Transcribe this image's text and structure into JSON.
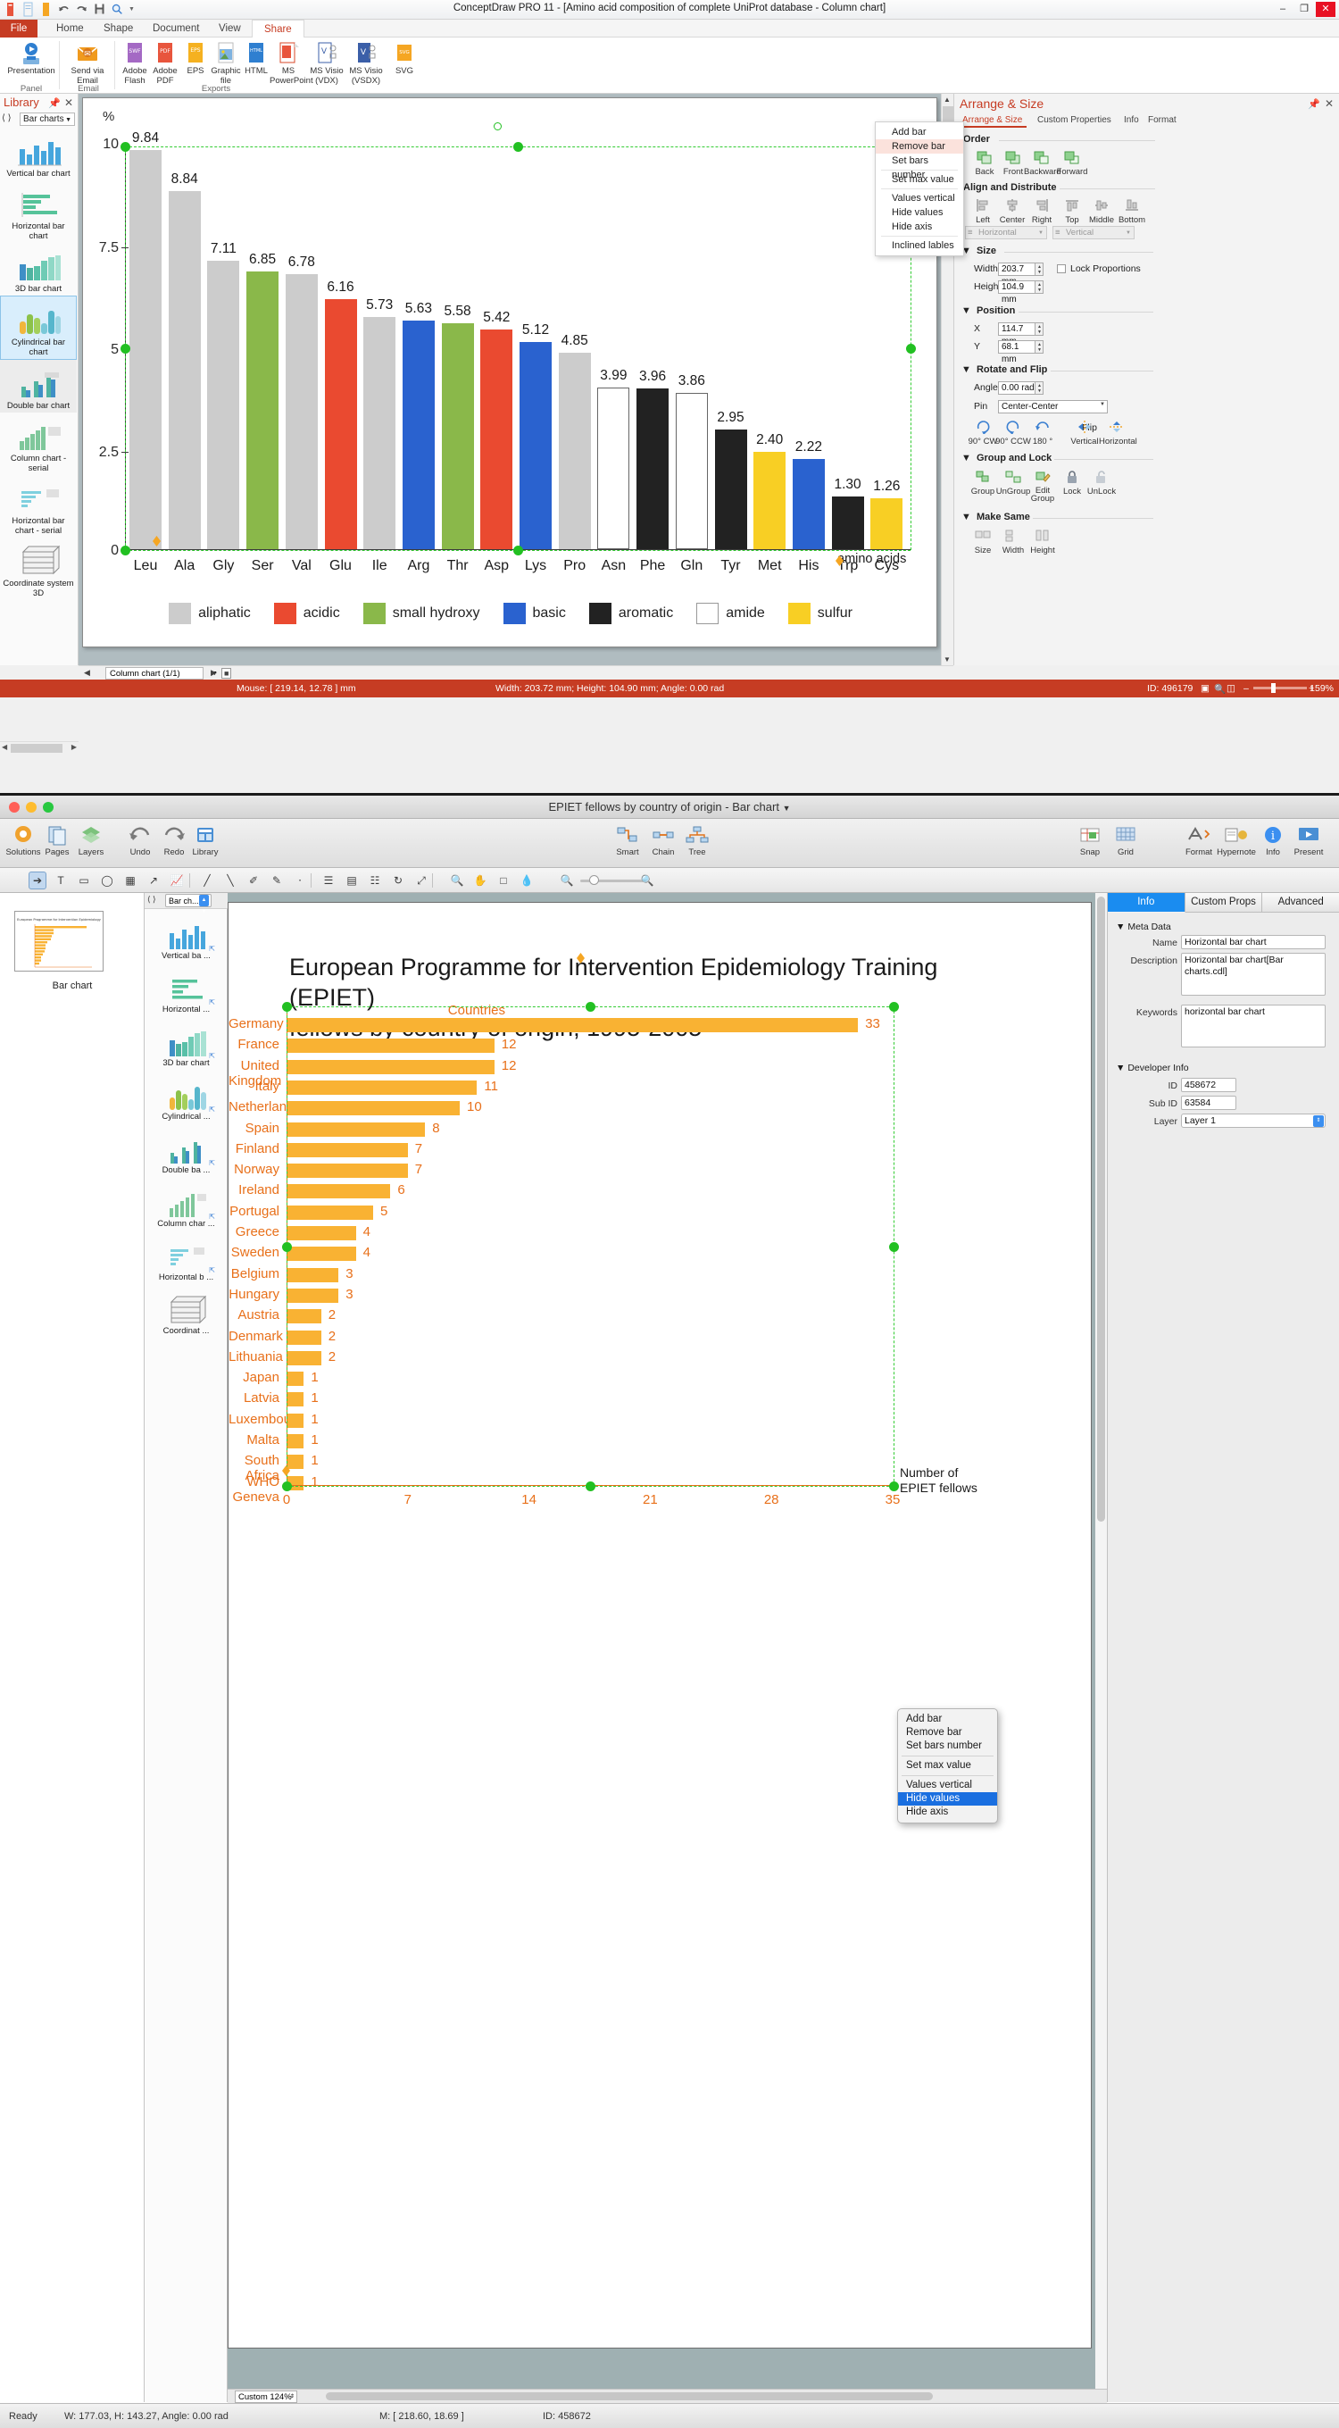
{
  "win1": {
    "title": "ConceptDraw PRO 11 - [Amino acid composition of complete UniProt database - Column chart]",
    "window_buttons": {
      "minimize": "–",
      "maximize": "❐",
      "close": "✕"
    },
    "ribbon_tabs": [
      {
        "label": "File"
      },
      {
        "label": "Home"
      },
      {
        "label": "Shape"
      },
      {
        "label": "Document"
      },
      {
        "label": "View"
      },
      {
        "label": "Share"
      }
    ],
    "ribbon_groups": [
      {
        "label": "Panel",
        "items": [
          {
            "label": "Presentation",
            "icon": "presentation-icon"
          }
        ]
      },
      {
        "label": "Email",
        "items": [
          {
            "label": "Send via Email",
            "icon": "email-icon"
          }
        ]
      },
      {
        "label": "Exports",
        "items": [
          {
            "label": "Adobe Flash",
            "icon": "swf-icon",
            "tag": "SWF"
          },
          {
            "label": "Adobe PDF",
            "icon": "pdf-icon",
            "tag": "PDF"
          },
          {
            "label": "EPS",
            "icon": "eps-icon",
            "tag": "EPS"
          },
          {
            "label": "Graphic file",
            "icon": "image-icon",
            "tag": ""
          },
          {
            "label": "HTML",
            "icon": "html-icon",
            "tag": "HTML"
          },
          {
            "label": "MS PowerPoint",
            "icon": "powerpoint-icon",
            "tag": ""
          },
          {
            "label": "MS Visio (VDX)",
            "icon": "visio-vdx-icon",
            "tag": "V"
          },
          {
            "label": "MS Visio (VSDX)",
            "icon": "visio-vsdx-icon",
            "tag": "V"
          },
          {
            "label": "SVG",
            "icon": "svg-icon",
            "tag": "SVG"
          }
        ]
      }
    ],
    "library": {
      "title": "Library",
      "selector_value": "Bar charts",
      "items": [
        {
          "label": "Vertical bar chart",
          "selected": false
        },
        {
          "label": "Horizontal bar chart",
          "selected": false
        },
        {
          "label": "3D bar chart",
          "selected": false
        },
        {
          "label": "Cylindrical bar chart",
          "selected": true
        },
        {
          "label": "Double bar chart",
          "selected": false
        },
        {
          "label": "Column chart - serial",
          "selected": false
        },
        {
          "label": "Horizontal bar chart - serial",
          "selected": false
        },
        {
          "label": "Coordinate system 3D",
          "selected": false
        }
      ]
    },
    "page_tab": "Column chart (1/1)",
    "context_menu": {
      "items": [
        {
          "label": "Add bar",
          "highlight": false
        },
        {
          "label": "Remove bar",
          "highlight": true
        },
        {
          "label": "Set bars number",
          "highlight": false
        },
        {
          "label": "Set max value",
          "highlight": false,
          "sep_before": true
        },
        {
          "label": "Values vertical",
          "highlight": false,
          "sep_before": true
        },
        {
          "label": "Hide values",
          "highlight": false
        },
        {
          "label": "Hide axis",
          "highlight": false
        },
        {
          "label": "Inclined lables",
          "highlight": false,
          "sep_before": true
        }
      ]
    },
    "dock": {
      "title": "Arrange & Size",
      "tabs": [
        {
          "label": "Arrange & Size",
          "active": true
        },
        {
          "label": "Custom Properties",
          "active": false
        },
        {
          "label": "Info",
          "active": false
        },
        {
          "label": "Format",
          "active": false
        }
      ],
      "sections": {
        "order": {
          "label": "Order",
          "buttons": [
            "Back",
            "Front",
            "Backward",
            "Forward"
          ]
        },
        "align": {
          "label": "Align and Distribute",
          "buttons": [
            "Left",
            "Center",
            "Right",
            "Top",
            "Middle",
            "Bottom"
          ],
          "dist_h": "Horizontal",
          "dist_v": "Vertical"
        },
        "size": {
          "label": "Size",
          "width_label": "Width",
          "width_value": "203.7 mm",
          "height_label": "Height",
          "height_value": "104.9 mm",
          "lock_label": "Lock Proportions"
        },
        "position": {
          "label": "Position",
          "x_label": "X",
          "x_value": "114.7 mm",
          "y_label": "Y",
          "y_value": "68.1 mm"
        },
        "rotate": {
          "label": "Rotate and Flip",
          "angle_label": "Angle",
          "angle_value": "0.00 rad",
          "pin_label": "Pin",
          "pin_value": "Center-Center",
          "buttons": [
            "90° CW",
            "90° CCW",
            "180 °",
            "Vertical",
            "Horizontal"
          ],
          "flip_label": "Flip"
        },
        "group": {
          "label": "Group and Lock",
          "buttons": [
            "Group",
            "UnGroup",
            "Edit Group",
            "Lock",
            "UnLock"
          ]
        },
        "same": {
          "label": "Make Same",
          "buttons": [
            "Size",
            "Width",
            "Height"
          ]
        }
      }
    },
    "status": {
      "mouse": "Mouse: [ 219.14, 12.78 ] mm",
      "dims": "Width: 203.72 mm;  Height: 104.90 mm;  Angle: 0.00 rad",
      "id": "ID: 496179",
      "zoom": "159%",
      "minus": "–",
      "plus": "+"
    }
  },
  "win2": {
    "title": "EPIET fellows by country of origin - Bar chart",
    "toolbar": [
      {
        "label": "Solutions",
        "icon": "solutions-icon"
      },
      {
        "label": "Pages",
        "icon": "pages-icon"
      },
      {
        "label": "Layers",
        "icon": "layers-icon"
      },
      {
        "label": "Undo",
        "icon": "undo-icon"
      },
      {
        "label": "Redo",
        "icon": "redo-icon"
      },
      {
        "label": "Library",
        "icon": "library-icon"
      },
      {
        "label": "Smart",
        "icon": "smart-connector-icon"
      },
      {
        "label": "Chain",
        "icon": "chain-connector-icon"
      },
      {
        "label": "Tree",
        "icon": "tree-connector-icon"
      },
      {
        "label": "Snap",
        "icon": "snap-icon"
      },
      {
        "label": "Grid",
        "icon": "grid-icon"
      },
      {
        "label": "Format",
        "icon": "format-icon"
      },
      {
        "label": "Hypernote",
        "icon": "hypernote-icon"
      },
      {
        "label": "Info",
        "icon": "info-icon"
      },
      {
        "label": "Present",
        "icon": "present-icon"
      }
    ],
    "pages": {
      "thumb_caption": "Bar chart"
    },
    "library": {
      "selector_value": "Bar ch...",
      "items": [
        {
          "label": "Vertical ba ..."
        },
        {
          "label": "Horizontal ..."
        },
        {
          "label": "3D bar chart"
        },
        {
          "label": "Cylindrical ..."
        },
        {
          "label": "Double ba ..."
        },
        {
          "label": "Column char ..."
        },
        {
          "label": "Horizontal b ..."
        },
        {
          "label": "Coordinat ..."
        }
      ]
    },
    "context_menu": {
      "items": [
        {
          "label": "Add bar",
          "selected": false
        },
        {
          "label": "Remove bar",
          "selected": false
        },
        {
          "label": "Set bars number",
          "selected": false
        },
        {
          "label": "Set max value",
          "selected": false,
          "sep_before": true
        },
        {
          "label": "Values vertical",
          "selected": false,
          "sep_before": true
        },
        {
          "label": "Hide values",
          "selected": true
        },
        {
          "label": "Hide axis",
          "selected": false
        }
      ]
    },
    "inspector": {
      "tabs": [
        {
          "label": "Info",
          "active": true
        },
        {
          "label": "Custom Props",
          "active": false
        },
        {
          "label": "Advanced",
          "active": false
        }
      ],
      "meta_section": "Meta Data",
      "fields": [
        {
          "label": "Name",
          "value": "Horizontal bar chart"
        },
        {
          "label": "Description",
          "value": "Horizontal bar chart[Bar charts.cdl]"
        },
        {
          "label": "Keywords",
          "value": "horizontal bar chart"
        }
      ],
      "developer_section": "Developer Info",
      "dev_fields": [
        {
          "label": "ID",
          "value": "458672"
        },
        {
          "label": "Sub ID",
          "value": "63584"
        },
        {
          "label": "Layer",
          "value": "Layer 1"
        }
      ]
    },
    "status": {
      "ready": "Ready",
      "dims": "W: 177.03,  H: 143.27,  Angle: 0.00 rad",
      "mouse": "M: [ 218.60, 18.69 ]",
      "id": "ID: 458672",
      "zoom": "Custom 124%"
    }
  },
  "chart_data": [
    {
      "type": "bar",
      "title": "Amino acid composition of complete UniProt database",
      "xlabel": "amino acids",
      "ylabel": "%",
      "ylim": [
        0,
        10
      ],
      "yticks": [
        "0",
        "2.5",
        "5",
        "7.5",
        "10"
      ],
      "categories": [
        "Leu",
        "Ala",
        "Gly",
        "Ser",
        "Val",
        "Glu",
        "Ile",
        "Arg",
        "Thr",
        "Asp",
        "Lys",
        "Pro",
        "Asn",
        "Phe",
        "Gln",
        "Tyr",
        "Met",
        "His",
        "Trp",
        "Cys"
      ],
      "values": [
        9.84,
        8.84,
        7.11,
        6.85,
        6.78,
        6.16,
        5.73,
        5.63,
        5.58,
        5.42,
        5.12,
        4.85,
        3.99,
        3.96,
        3.86,
        2.95,
        2.4,
        2.22,
        1.3,
        1.26
      ],
      "value_labels": [
        "9.84",
        "8.84",
        "7.11",
        "6.85",
        "6.78",
        "6.16",
        "5.73",
        "5.63",
        "5.58",
        "5.42",
        "5.12",
        "4.85",
        "3.99",
        "3.96",
        "3.86",
        "2.95",
        "2.40",
        "2.22",
        "1.30",
        "1.26"
      ],
      "bar_groups": [
        "aliphatic",
        "aliphatic",
        "aliphatic",
        "small hydroxy",
        "aliphatic",
        "acidic",
        "aliphatic",
        "basic",
        "small hydroxy",
        "acidic",
        "basic",
        "aliphatic",
        "amide",
        "aromatic",
        "amide",
        "aromatic",
        "sulfur",
        "basic",
        "aromatic",
        "sulfur"
      ],
      "legend": [
        {
          "label": "aliphatic",
          "color": "#cccccc"
        },
        {
          "label": "acidic",
          "color": "#ea4a30"
        },
        {
          "label": "small hydroxy",
          "color": "#8cb royal"
        },
        {
          "label": "basic",
          "color": "#2a62cf"
        },
        {
          "label": "aromatic",
          "color": "#222222"
        },
        {
          "label": "amide",
          "color": "#ffffff"
        },
        {
          "label": "sulfur",
          "color": "#f8cf24"
        }
      ],
      "legend_position": "bottom"
    },
    {
      "type": "bar",
      "orientation": "horizontal",
      "title": "European Programme for Intervention Epidemiology Training (EPIET) fellows by country of origin, 1995-2005",
      "title_line1": "European Programme for Intervention Epidemiology Training (EPIET)",
      "title_line2": "fellows by country of origin, 1995-2005",
      "ylabel": "Countries",
      "xlabel": "Number of EPIET fellows",
      "xlabel_line1": "Number of",
      "xlabel_line2": "EPIET fellows",
      "xlim": [
        0,
        35
      ],
      "xticks": [
        "0",
        "7",
        "14",
        "21",
        "28",
        "35"
      ],
      "categories": [
        "Germany",
        "France",
        "United Kingdom",
        "Italy",
        "Netherlands",
        "Spain",
        "Finland",
        "Norway",
        "Ireland",
        "Portugal",
        "Greece",
        "Sweden",
        "Belgium",
        "Hungary",
        "Austria",
        "Denmark",
        "Lithuania",
        "Japan",
        "Latvia",
        "Luxembourg",
        "Malta",
        "South Africa",
        "WHO Geneva"
      ],
      "values": [
        33,
        12,
        12,
        11,
        10,
        8,
        7,
        7,
        6,
        5,
        4,
        4,
        3,
        3,
        2,
        2,
        2,
        1,
        1,
        1,
        1,
        1,
        1
      ],
      "bar_color": "#f9b233",
      "label_color": "#e8701a"
    }
  ],
  "colors": {
    "aliphatic": "#cccccc",
    "acidic": "#ea4a30",
    "small_hydroxy": "#8ab84a",
    "basic": "#2a62cf",
    "aromatic": "#222222",
    "amide": "#ffffff",
    "sulfur": "#f8cf24",
    "accent_red": "#c63c23",
    "selection_green": "#22c022",
    "mac_accent_blue": "#1a6fe0"
  }
}
